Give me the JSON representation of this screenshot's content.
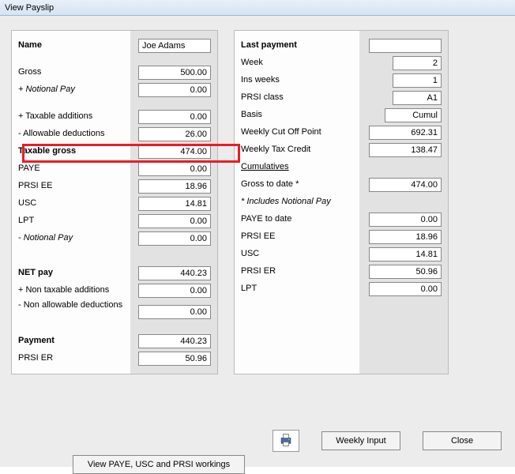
{
  "title": "View Payslip",
  "left": {
    "name_label": "Name",
    "name_value": "Joe Adams",
    "gross_label": "Gross",
    "gross_value": "500.00",
    "notional_add_label": "+ Notional Pay",
    "notional_add_value": "0.00",
    "taxable_additions_label": "+ Taxable additions",
    "taxable_additions_value": "0.00",
    "allowable_ded_label": "- Allowable deductions",
    "allowable_ded_value": "26.00",
    "taxable_gross_label": "Taxable gross",
    "taxable_gross_value": "474.00",
    "paye_label": "PAYE",
    "paye_value": "0.00",
    "prsi_ee_label": "PRSI EE",
    "prsi_ee_value": "18.96",
    "usc_label": "USC",
    "usc_value": "14.81",
    "lpt_label": "LPT",
    "lpt_value": "0.00",
    "notional_sub_label": "- Notional Pay",
    "notional_sub_value": "0.00",
    "net_label": "NET pay",
    "net_value": "440.23",
    "nontax_add_label": "+ Non taxable additions",
    "nontax_add_value": "0.00",
    "nonallow_ded_label": "- Non allowable deductions",
    "nonallow_ded_value": "0.00",
    "payment_label": "Payment",
    "payment_value": "440.23",
    "prsi_er_label": "PRSI ER",
    "prsi_er_value": "50.96"
  },
  "right": {
    "last_payment_label": "Last payment",
    "last_payment_value": "",
    "week_label": "Week",
    "week_value": "2",
    "ins_weeks_label": "Ins weeks",
    "ins_weeks_value": "1",
    "prsi_class_label": "PRSI class",
    "prsi_class_value": "A1",
    "basis_label": "Basis",
    "basis_value": "Cumul",
    "cutoff_label": "Weekly Cut Off Point",
    "cutoff_value": "692.31",
    "taxcredit_label": "Weekly Tax Credit",
    "taxcredit_value": "138.47",
    "cumulatives_label": "Cumulatives",
    "gross_to_date_label": "Gross to date *",
    "gross_to_date_value": "474.00",
    "includes_notional_label": "* Includes Notional Pay",
    "paye_to_date_label": "PAYE to date",
    "paye_to_date_value": "0.00",
    "prsi_ee_label": "PRSI EE",
    "prsi_ee_value": "18.96",
    "usc_label": "USC",
    "usc_value": "14.81",
    "prsi_er_label": "PRSI ER",
    "prsi_er_value": "50.96",
    "lpt_label": "LPT",
    "lpt_value": "0.00"
  },
  "buttons": {
    "view_workings": "View PAYE, USC and PRSI workings",
    "weekly_input": "Weekly Input",
    "close": "Close"
  }
}
